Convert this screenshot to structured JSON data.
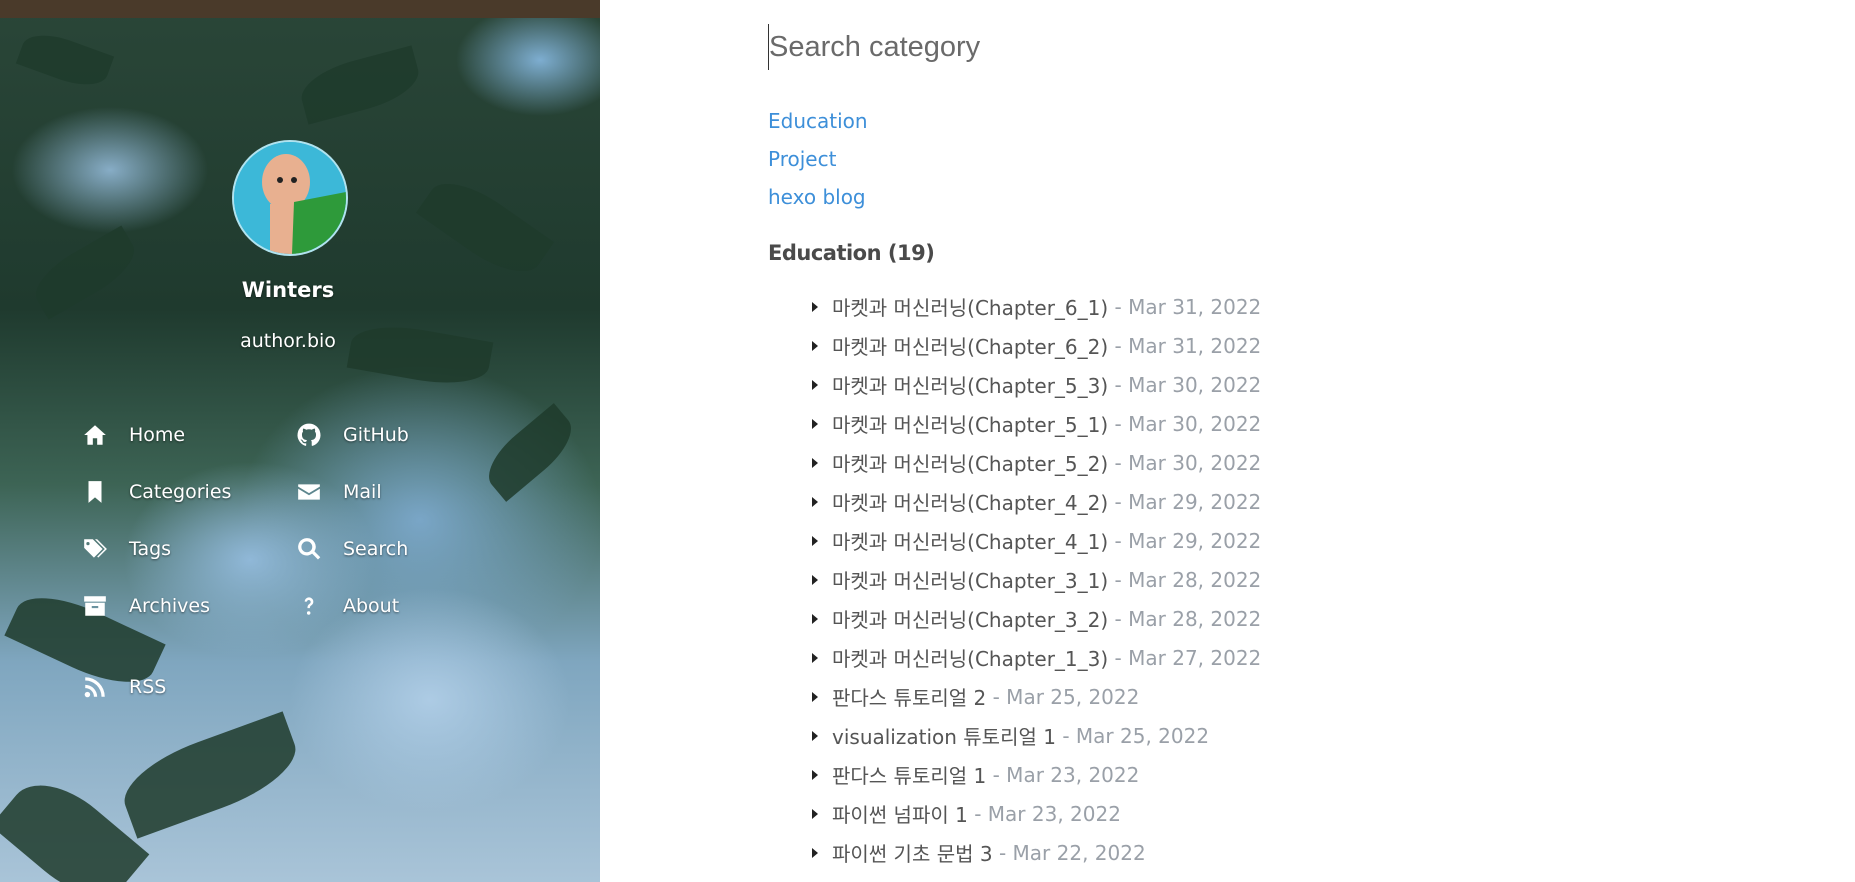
{
  "sidebar": {
    "author_name": "Winters",
    "author_bio": "author.bio",
    "nav": {
      "home": "Home",
      "github": "GitHub",
      "categories": "Categories",
      "mail": "Mail",
      "tags": "Tags",
      "search": "Search",
      "archives": "Archives",
      "about": "About",
      "rss": "RSS"
    },
    "icons": [
      "home-icon",
      "github-icon",
      "bookmark-icon",
      "envelope-icon",
      "tags-icon",
      "search-icon",
      "archive-icon",
      "question-icon",
      "rss-icon"
    ]
  },
  "main": {
    "search": {
      "placeholder": "Search category"
    },
    "categories": [
      "Education",
      "Project",
      "hexo blog"
    ],
    "section_title": "Education (19)",
    "posts": [
      {
        "title": "마켓과 머신러닝(Chapter_6_1)",
        "date": "- Mar 31, 2022"
      },
      {
        "title": "마켓과 머신러닝(Chapter_6_2)",
        "date": "- Mar 31, 2022"
      },
      {
        "title": "마켓과 머신러닝(Chapter_5_3)",
        "date": "- Mar 30, 2022"
      },
      {
        "title": "마켓과 머신러닝(Chapter_5_1)",
        "date": "- Mar 30, 2022"
      },
      {
        "title": "마켓과 머신러닝(Chapter_5_2)",
        "date": "- Mar 30, 2022"
      },
      {
        "title": "마켓과 머신러닝(Chapter_4_2)",
        "date": "- Mar 29, 2022"
      },
      {
        "title": "마켓과 머신러닝(Chapter_4_1)",
        "date": "- Mar 29, 2022"
      },
      {
        "title": "마켓과 머신러닝(Chapter_3_1)",
        "date": "- Mar 28, 2022"
      },
      {
        "title": "마켓과 머신러닝(Chapter_3_2)",
        "date": "- Mar 28, 2022"
      },
      {
        "title": "마켓과 머신러닝(Chapter_1_3)",
        "date": "- Mar 27, 2022"
      },
      {
        "title": "판다스 튜토리얼 2",
        "date": "- Mar 25, 2022"
      },
      {
        "title": "visualization 튜토리얼 1",
        "date": "- Mar 25, 2022"
      },
      {
        "title": "판다스 튜토리얼 1",
        "date": "- Mar 23, 2022"
      },
      {
        "title": "파이썬 넘파이 1",
        "date": "- Mar 23, 2022"
      },
      {
        "title": "파이썬 기초 문법 3",
        "date": "- Mar 22, 2022"
      }
    ]
  },
  "colors": {
    "link": "#3d8fd9",
    "post_title": "#555555",
    "post_date": "#9aa0a8",
    "section_title": "#4a4a4a"
  }
}
